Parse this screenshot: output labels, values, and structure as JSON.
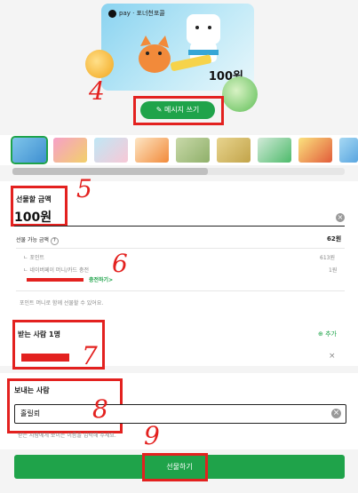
{
  "card": {
    "brand": "pay · 포너천포콜",
    "amount": "100원",
    "message_button": "메시지 쓰기"
  },
  "thumbnails": {
    "count": 9
  },
  "amount_section": {
    "label": "선물할 금액",
    "value": "100원"
  },
  "balance": {
    "label": "선물 가능 금액",
    "total": "62원",
    "items": [
      {
        "label": "ㄴ 포인트",
        "value": "613원"
      },
      {
        "label": "ㄴ 네이버페이 머니/카드 충전",
        "value": "1원"
      }
    ],
    "charge_link": "충전하기",
    "note": "포인트 머니로 함께 선물할 수 있어요."
  },
  "recipient": {
    "label": "받는 사람 1명",
    "add": "추가"
  },
  "sender": {
    "label": "보내는 사람",
    "value": "홀릴뢰",
    "note": "받는 사람에게 보이는 이름을 입력해 주세요."
  },
  "gift_button": "선물하기",
  "annotations": [
    "4",
    "5",
    "6",
    "7",
    "8",
    "9"
  ]
}
